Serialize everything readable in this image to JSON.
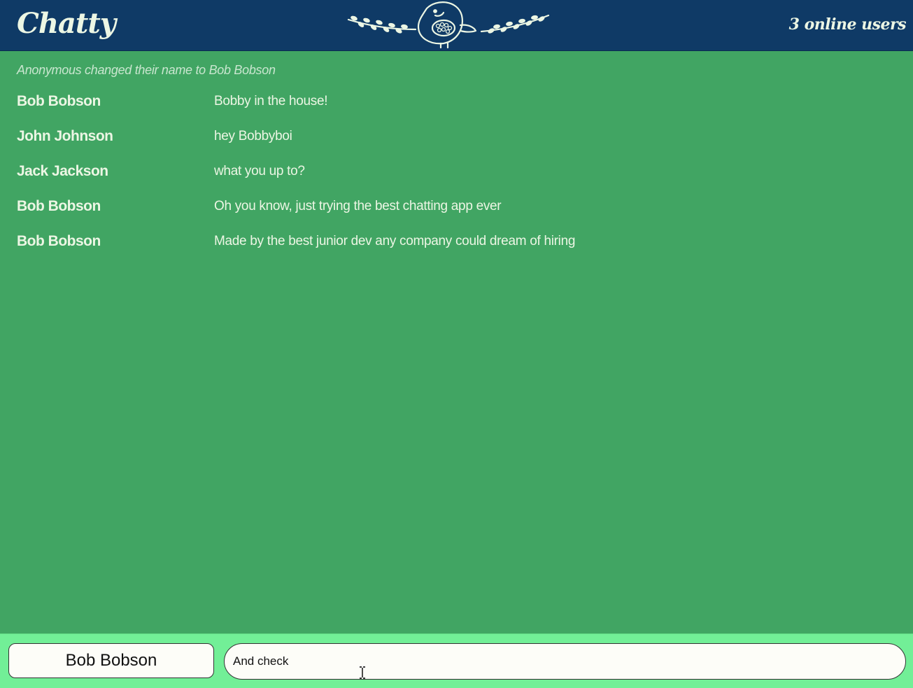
{
  "header": {
    "brand": "Chatty",
    "online_users": "3 online users",
    "logo_icon": "bird-logo-icon"
  },
  "messages": {
    "system_notice": "Anonymous changed their name to Bob Bobson",
    "items": [
      {
        "username": "Bob Bobson",
        "content": "Bobby in the house!"
      },
      {
        "username": "John Johnson",
        "content": "hey Bobbyboi"
      },
      {
        "username": "Jack Jackson",
        "content": "what you up to?"
      },
      {
        "username": "Bob Bobson",
        "content": "Oh you know, just trying the best chatting app ever"
      },
      {
        "username": "Bob Bobson",
        "content": "Made by the best junior dev any company could dream of hiring"
      }
    ]
  },
  "footer": {
    "username_value": "Bob Bobson",
    "message_value": "And check"
  },
  "colors": {
    "header_bg": "#0f3a66",
    "body_bg": "#41a563",
    "footer_bg": "#72ef97",
    "text_light": "#ecf6e4"
  }
}
